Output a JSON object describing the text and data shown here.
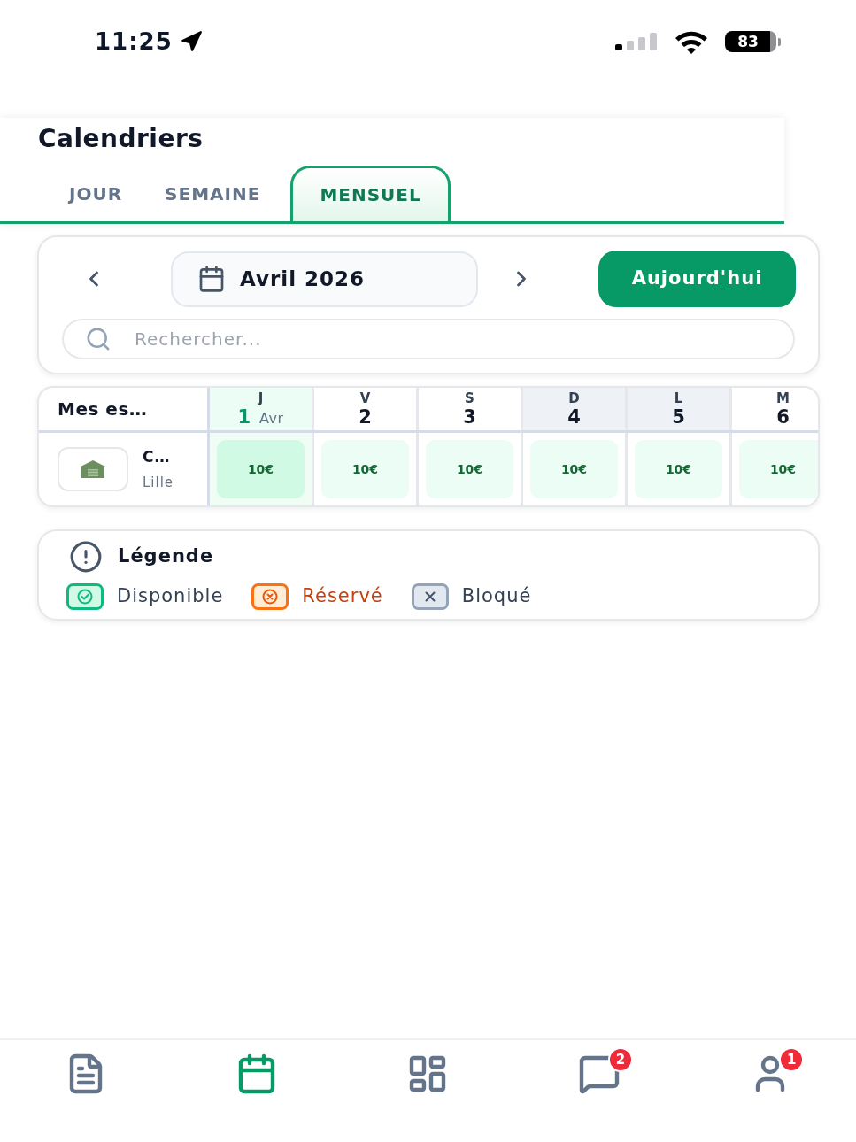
{
  "status_bar": {
    "time": "11:25",
    "battery": "83"
  },
  "header": {
    "title": "Calendriers",
    "tabs": [
      {
        "label": "JOUR",
        "selected": false
      },
      {
        "label": "SEMAINE",
        "selected": false
      },
      {
        "label": "MENSUEL",
        "selected": true
      }
    ]
  },
  "toolbar": {
    "month": "Avril 2026",
    "today_button": "Aujourd'hui",
    "search": {
      "placeholder": "Rechercher..."
    }
  },
  "calendar": {
    "corner": "Mes es…",
    "days": [
      {
        "weekday": "J",
        "day": "1",
        "month": "Avr",
        "today": true,
        "shaded": false
      },
      {
        "weekday": "V",
        "day": "2",
        "today": false,
        "shaded": false
      },
      {
        "weekday": "S",
        "day": "3",
        "today": false,
        "shaded": false
      },
      {
        "weekday": "D",
        "day": "4",
        "today": false,
        "shaded": true
      },
      {
        "weekday": "L",
        "day": "5",
        "today": false,
        "shaded": true
      },
      {
        "weekday": "M",
        "day": "6",
        "today": false,
        "shaded": false
      }
    ],
    "rows": [
      {
        "name": "C…",
        "city": "Lille",
        "cells": [
          {
            "price": "10€",
            "kind": "available"
          },
          {
            "price": "10€",
            "kind": "available"
          },
          {
            "price": "10€",
            "kind": "available"
          },
          {
            "price": "10€",
            "kind": "available"
          },
          {
            "price": "10€",
            "kind": "available"
          },
          {
            "price": "10€",
            "kind": "available"
          }
        ]
      }
    ]
  },
  "legend": {
    "title": "Légende",
    "items": [
      {
        "label": "Disponible",
        "kind": "available"
      },
      {
        "label": "Réservé",
        "kind": "reserved"
      },
      {
        "label": "Bloqué",
        "kind": "blocked"
      }
    ]
  },
  "bottom_nav": [
    {
      "kind": "documents",
      "selected": false
    },
    {
      "kind": "calendar",
      "selected": true
    },
    {
      "kind": "grid",
      "selected": false
    },
    {
      "kind": "messages",
      "selected": false,
      "badge": "2"
    },
    {
      "kind": "profile",
      "selected": false,
      "badge": "1"
    }
  ]
}
